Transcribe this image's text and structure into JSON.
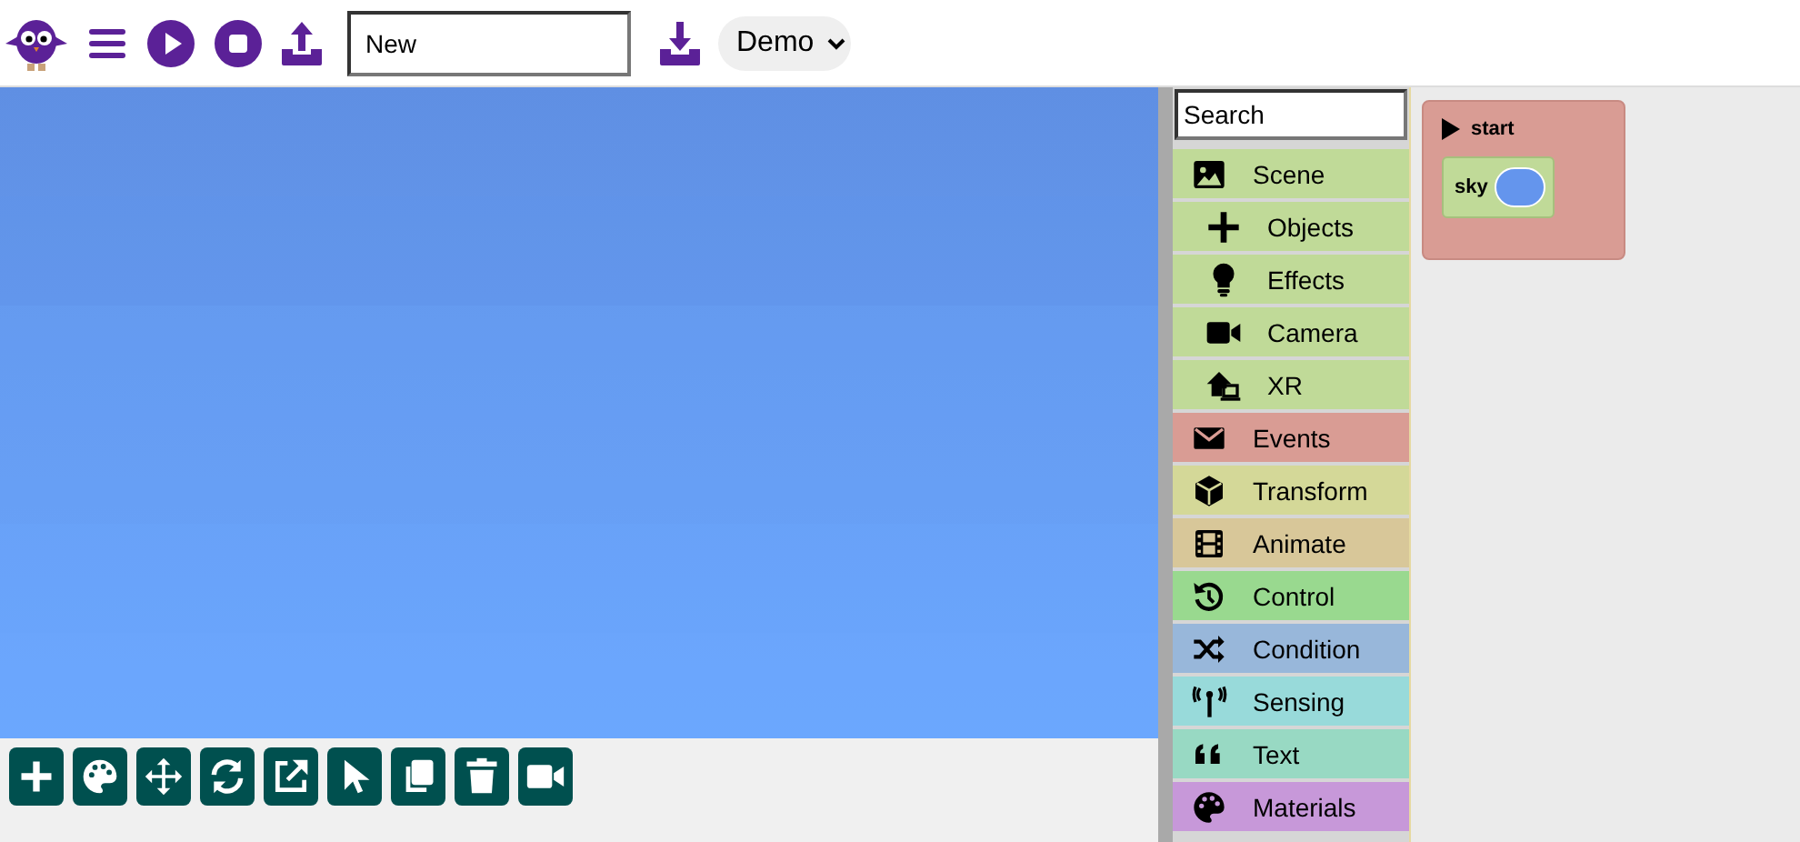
{
  "toolbar": {
    "project_name": "New",
    "example_select": "Demo"
  },
  "palette": {
    "search": {
      "placeholder": "Search"
    },
    "categories": [
      {
        "label": "Scene",
        "color": "#c0da98",
        "children": [
          {
            "label": "Objects"
          },
          {
            "label": "Effects"
          },
          {
            "label": "Camera"
          },
          {
            "label": "XR"
          }
        ]
      },
      {
        "label": "Events",
        "color": "#d99c94"
      },
      {
        "label": "Transform",
        "color": "#d4d898"
      },
      {
        "label": "Animate",
        "color": "#d8c799"
      },
      {
        "label": "Control",
        "color": "#99d98f"
      },
      {
        "label": "Condition",
        "color": "#98b7da"
      },
      {
        "label": "Sensing",
        "color": "#98dada"
      },
      {
        "label": "Text",
        "color": "#98d9c3"
      },
      {
        "label": "Materials",
        "color": "#c798d9"
      }
    ]
  },
  "workspace": {
    "blocks": [
      {
        "label": "start",
        "children": [
          {
            "label": "sky",
            "color": "#6495ed"
          }
        ]
      }
    ]
  }
}
